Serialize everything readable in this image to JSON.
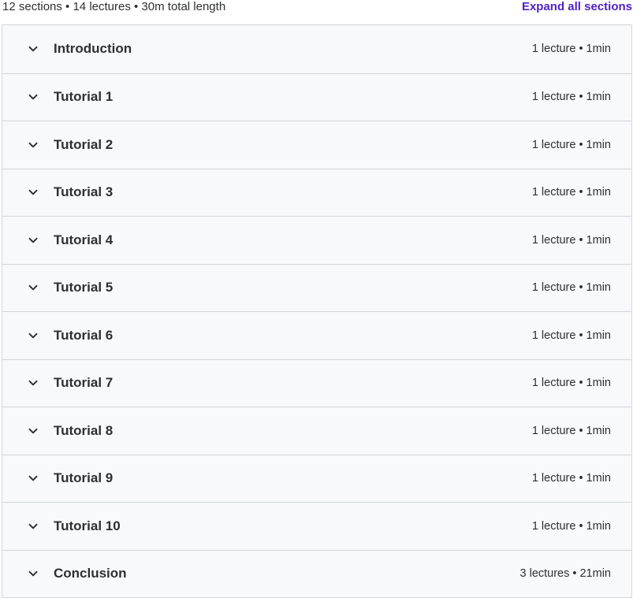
{
  "summary": {
    "text": "12 sections • 14 lectures • 30m total length",
    "expand_all_label": "Expand all sections"
  },
  "sections": [
    {
      "title": "Introduction",
      "meta": "1 lecture • 1min"
    },
    {
      "title": "Tutorial 1",
      "meta": "1 lecture • 1min"
    },
    {
      "title": "Tutorial 2",
      "meta": "1 lecture • 1min"
    },
    {
      "title": "Tutorial 3",
      "meta": "1 lecture • 1min"
    },
    {
      "title": "Tutorial 4",
      "meta": "1 lecture • 1min"
    },
    {
      "title": "Tutorial 5",
      "meta": "1 lecture • 1min"
    },
    {
      "title": "Tutorial 6",
      "meta": "1 lecture • 1min"
    },
    {
      "title": "Tutorial 7",
      "meta": "1 lecture • 1min"
    },
    {
      "title": "Tutorial 8",
      "meta": "1 lecture • 1min"
    },
    {
      "title": "Tutorial 9",
      "meta": "1 lecture • 1min"
    },
    {
      "title": "Tutorial 10",
      "meta": "1 lecture • 1min"
    },
    {
      "title": "Conclusion",
      "meta": "3 lectures • 21min"
    }
  ],
  "icons": {
    "section_toggle": "chevron-down-icon"
  },
  "colors": {
    "accent": "#5022c3",
    "row_background": "#f7f9fa",
    "border": "#d1d7dc",
    "text": "#2d2f31"
  }
}
